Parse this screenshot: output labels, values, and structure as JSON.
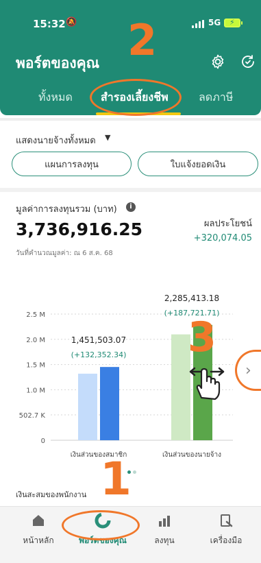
{
  "status": {
    "time": "15:32",
    "network": "5G"
  },
  "header": {
    "title": "พอร์ตของคุณ",
    "tabs": [
      "ทั้งหมด",
      "สำรองเลี้ยงชีพ",
      "ลดภาษี"
    ],
    "active_tab": 1
  },
  "annotations": {
    "step2": "2",
    "step3": "3",
    "step1": "1"
  },
  "filter": {
    "label": "แสดงนายจ้างทั้งหมด"
  },
  "buttons": {
    "plan": "แผนการลงทุน",
    "statement": "ใบแจ้งยอดเงิน"
  },
  "summary": {
    "label": "มูลค่าการลงทุนรวม (บาท)",
    "total": "3,736,916.25",
    "date": "วันที่คำนวณมูลค่า: ณ 6 ส.ค. 68",
    "profit_label": "ผลประโยชน์",
    "profit_value": "+320,074.05"
  },
  "chart_data": {
    "type": "bar",
    "categories": [
      "เงินส่วนของสมาชิก",
      "เงินส่วนของนายจ้าง"
    ],
    "series": [
      {
        "values": [
          1319150.73,
          2097691.47
        ]
      },
      {
        "values": [
          1451503.07,
          2285413.18
        ]
      }
    ],
    "data_labels": [
      {
        "total": "1,451,503.07",
        "gain": "(+132,352.34)"
      },
      {
        "total": "2,285,413.18",
        "gain": "(+187,721.71)"
      }
    ],
    "yticks": [
      "0",
      "502.7 K",
      "1.0 M",
      "1.5 M",
      "2.0 M",
      "2.5 M"
    ],
    "ylim": [
      0,
      2500000
    ],
    "grid": true,
    "colors": {
      "member": [
        "#c4dcfb",
        "#3a7fe3"
      ],
      "employer": [
        "#cfe9c4",
        "#5aa64a"
      ]
    }
  },
  "accumulated": {
    "label": "เงินสะสมของพนักงาน"
  },
  "bottom_nav": [
    {
      "label": "หน้าหลัก",
      "icon": "home-icon"
    },
    {
      "label": "พอร์ตของคุณ",
      "icon": "portfolio-icon"
    },
    {
      "label": "ลงทุน",
      "icon": "invest-icon"
    },
    {
      "label": "เครื่องมือ",
      "icon": "tools-icon"
    }
  ],
  "colors": {
    "brand": "#1f8a74",
    "accent": "#f2c811",
    "annotation": "#f0772a"
  }
}
